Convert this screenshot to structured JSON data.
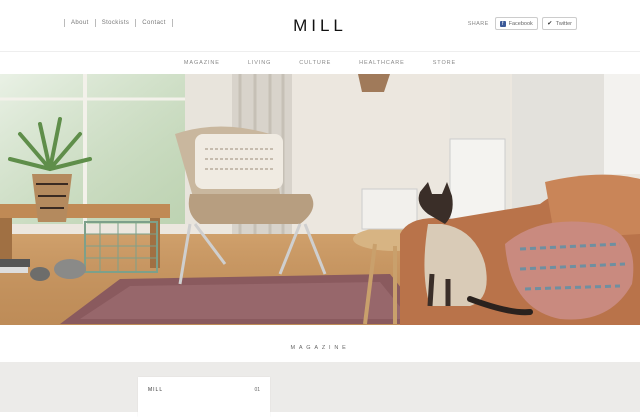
{
  "header": {
    "links": [
      "About",
      "Stockists",
      "Contact"
    ],
    "logo": "MILL",
    "share_label": "SHARE",
    "share_buttons": [
      {
        "label": "Facebook",
        "icon": "facebook-icon"
      },
      {
        "label": "Twitter",
        "icon": "twitter-icon"
      }
    ]
  },
  "nav": {
    "items": [
      "MAGAZINE",
      "LIVING",
      "CULTURE",
      "HEALTHCARE",
      "STORE"
    ]
  },
  "hero": {
    "description": ""
  },
  "section": {
    "title": "MAGAZINE"
  },
  "card": {
    "brand": "MILL",
    "issue": "01"
  },
  "colors": {
    "background": "#ffffff",
    "band": "#ecebe9",
    "text": "#333333"
  }
}
